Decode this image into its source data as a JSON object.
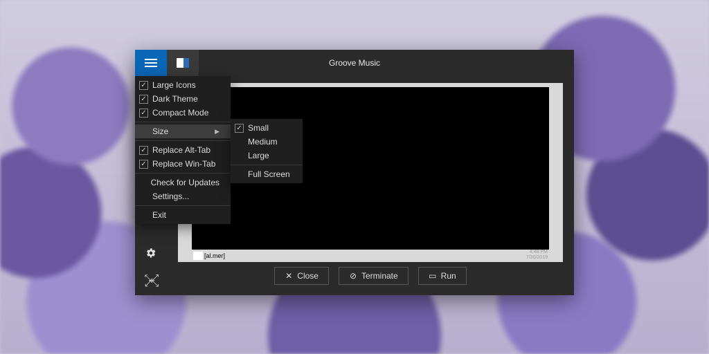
{
  "window": {
    "title": "Groove Music"
  },
  "menu": {
    "large_icons": "Large Icons",
    "dark_theme": "Dark Theme",
    "compact_mode": "Compact Mode",
    "size": "Size",
    "replace_alt_tab": "Replace Alt-Tab",
    "replace_win_tab": "Replace Win-Tab",
    "check_updates": "Check for Updates",
    "settings": "Settings...",
    "exit": "Exit"
  },
  "size_submenu": {
    "small": "Small",
    "medium": "Medium",
    "large": "Large",
    "full_screen": "Full Screen"
  },
  "buttons": {
    "close": "Close",
    "terminate": "Terminate",
    "run": "Run"
  },
  "preview": {
    "caption": "[al.mer]",
    "time": "4:48 PM",
    "date": "7/30/2019"
  }
}
